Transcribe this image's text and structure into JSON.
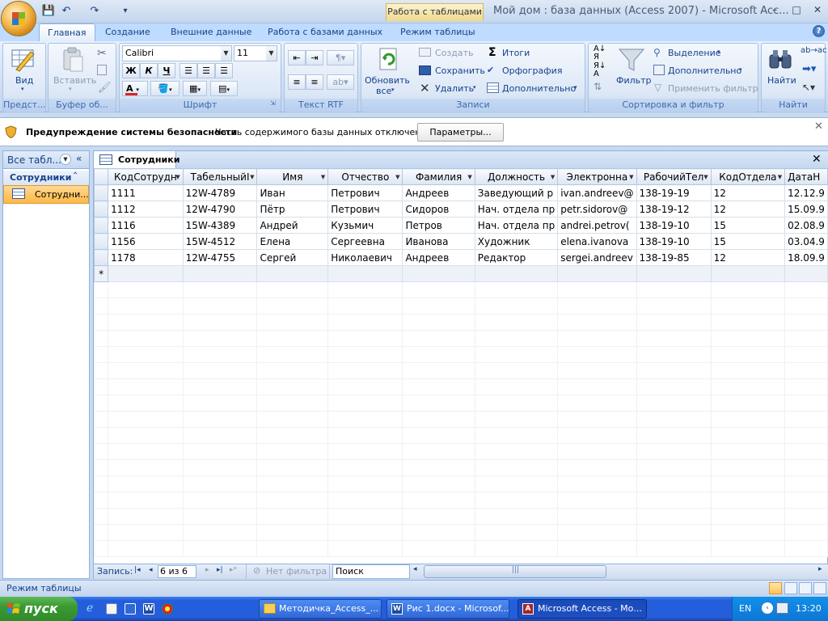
{
  "window": {
    "title": "Мой дом : база данных (Access 2007) - Microsoft Acc...",
    "context_tab": "Работа с таблицами",
    "minimize": "–",
    "maximize": "□",
    "close": "✕"
  },
  "qat": {
    "save": "💾",
    "undo": "↶",
    "redo": "↷",
    "customize": "▾"
  },
  "ribbon": {
    "tabs": [
      "Главная",
      "Создание",
      "Внешние данные",
      "Работа с базами данных",
      "Режим таблицы"
    ],
    "active_tab": "Главная",
    "help": "?",
    "groups": {
      "views": {
        "label": "Предст...",
        "button": "Вид"
      },
      "clipboard": {
        "label": "Буфер об...",
        "paste": "Вставить"
      },
      "font": {
        "label": "Шрифт",
        "font_name": "Calibri",
        "font_size": "11",
        "bold": "Ж",
        "italic": "К",
        "underline": "Ч",
        "font_color_glyph": "A"
      },
      "rtf": {
        "label": "Текст RTF"
      },
      "records": {
        "label": "Записи",
        "refresh": "Обновить",
        "refresh2": "все",
        "new": "Создать",
        "save": "Сохранить",
        "delete": "Удалить",
        "totals": "Итоги",
        "spelling": "Орфография",
        "more": "Дополнительно"
      },
      "sort_filter": {
        "label": "Сортировка и фильтр",
        "filter": "Фильтр",
        "selection": "Выделение",
        "advanced": "Дополнительно",
        "toggle_filter": "Применить фильтр"
      },
      "find": {
        "label": "Найти",
        "find": "Найти"
      }
    }
  },
  "security": {
    "title": "Предупреждение системы безопасности",
    "text": "Часть содержимого базы данных отключено",
    "button": "Параметры..."
  },
  "nav_pane": {
    "header": "Все табл...",
    "group": "Сотрудники",
    "item": "Сотрудни..."
  },
  "document": {
    "tab": "Сотрудники",
    "columns": [
      "КодСотрудн",
      "ТабельныйI",
      "Имя",
      "Отчество",
      "Фамилия",
      "Должность",
      "Электронна",
      "РабочийТел",
      "КодОтдела",
      "ДатаН"
    ],
    "rows": [
      [
        "1111",
        "12W-4789",
        "Иван",
        "Петрович",
        "Андреев",
        "Заведующий р",
        "ivan.andreev@",
        "138-19-19",
        "12",
        "12.12.9"
      ],
      [
        "1112",
        "12W-4790",
        "Пётр",
        "Петрович",
        "Сидоров",
        "Нач. отдела пр",
        "petr.sidorov@",
        "138-19-12",
        "12",
        "15.09.9"
      ],
      [
        "1116",
        "15W-4389",
        "Андрей",
        "Кузьмич",
        "Петров",
        "Нач. отдела пр",
        "andrei.petrov(",
        "138-19-10",
        "15",
        "02.08.9"
      ],
      [
        "1156",
        "15W-4512",
        "Елена",
        "Сергеевна",
        "Иванова",
        "Художник",
        "elena.ivanova",
        "138-19-10",
        "15",
        "03.04.9"
      ],
      [
        "1178",
        "12W-4755",
        "Сергей",
        "Николаевич",
        "Андреев",
        "Редактор",
        "sergei.andreev",
        "138-19-85",
        "12",
        "18.09.9"
      ]
    ],
    "new_row_marker": "*"
  },
  "record_nav": {
    "label": "Запись:",
    "first": "|◂",
    "prev": "◂",
    "current": "6 из 6",
    "next": "▸",
    "last": "▸|",
    "new": "▸*",
    "filter": "Нет фильтра",
    "search": "Поиск"
  },
  "status_bar": {
    "text": "Режим таблицы"
  },
  "taskbar": {
    "start": "пуск",
    "windows": [
      "Методичка_Access_...",
      "Рис 1.docx - Microsof...",
      "Microsoft Access - Мо..."
    ],
    "active_window_index": 2,
    "language": "EN",
    "clock": "13:20"
  },
  "colors": {
    "accent": "#15428b",
    "ribbon": "#bfdbff",
    "selection": "#ffc35a",
    "taskbar": "#245edb",
    "start": "#3a9a32"
  }
}
